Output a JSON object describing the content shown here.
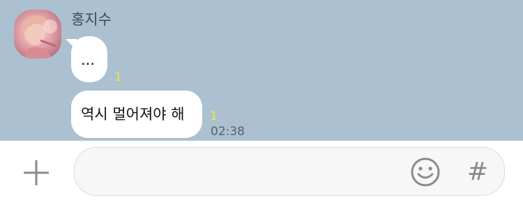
{
  "chat": {
    "sender_name": "홍지수",
    "messages": [
      {
        "text": "...",
        "unread": "1"
      },
      {
        "text": "역시 멀어져야 해",
        "unread": "1",
        "time": "02:38"
      }
    ]
  },
  "input_bar": {
    "placeholder": "",
    "hash_label": "#",
    "icons": [
      "plus-icon",
      "emoji-icon",
      "hashtag-icon"
    ]
  },
  "colors": {
    "chat_background": "#abc1d1",
    "bubble": "#ffffff",
    "unread_count": "#f3e73c",
    "timestamp": "#55636d"
  }
}
